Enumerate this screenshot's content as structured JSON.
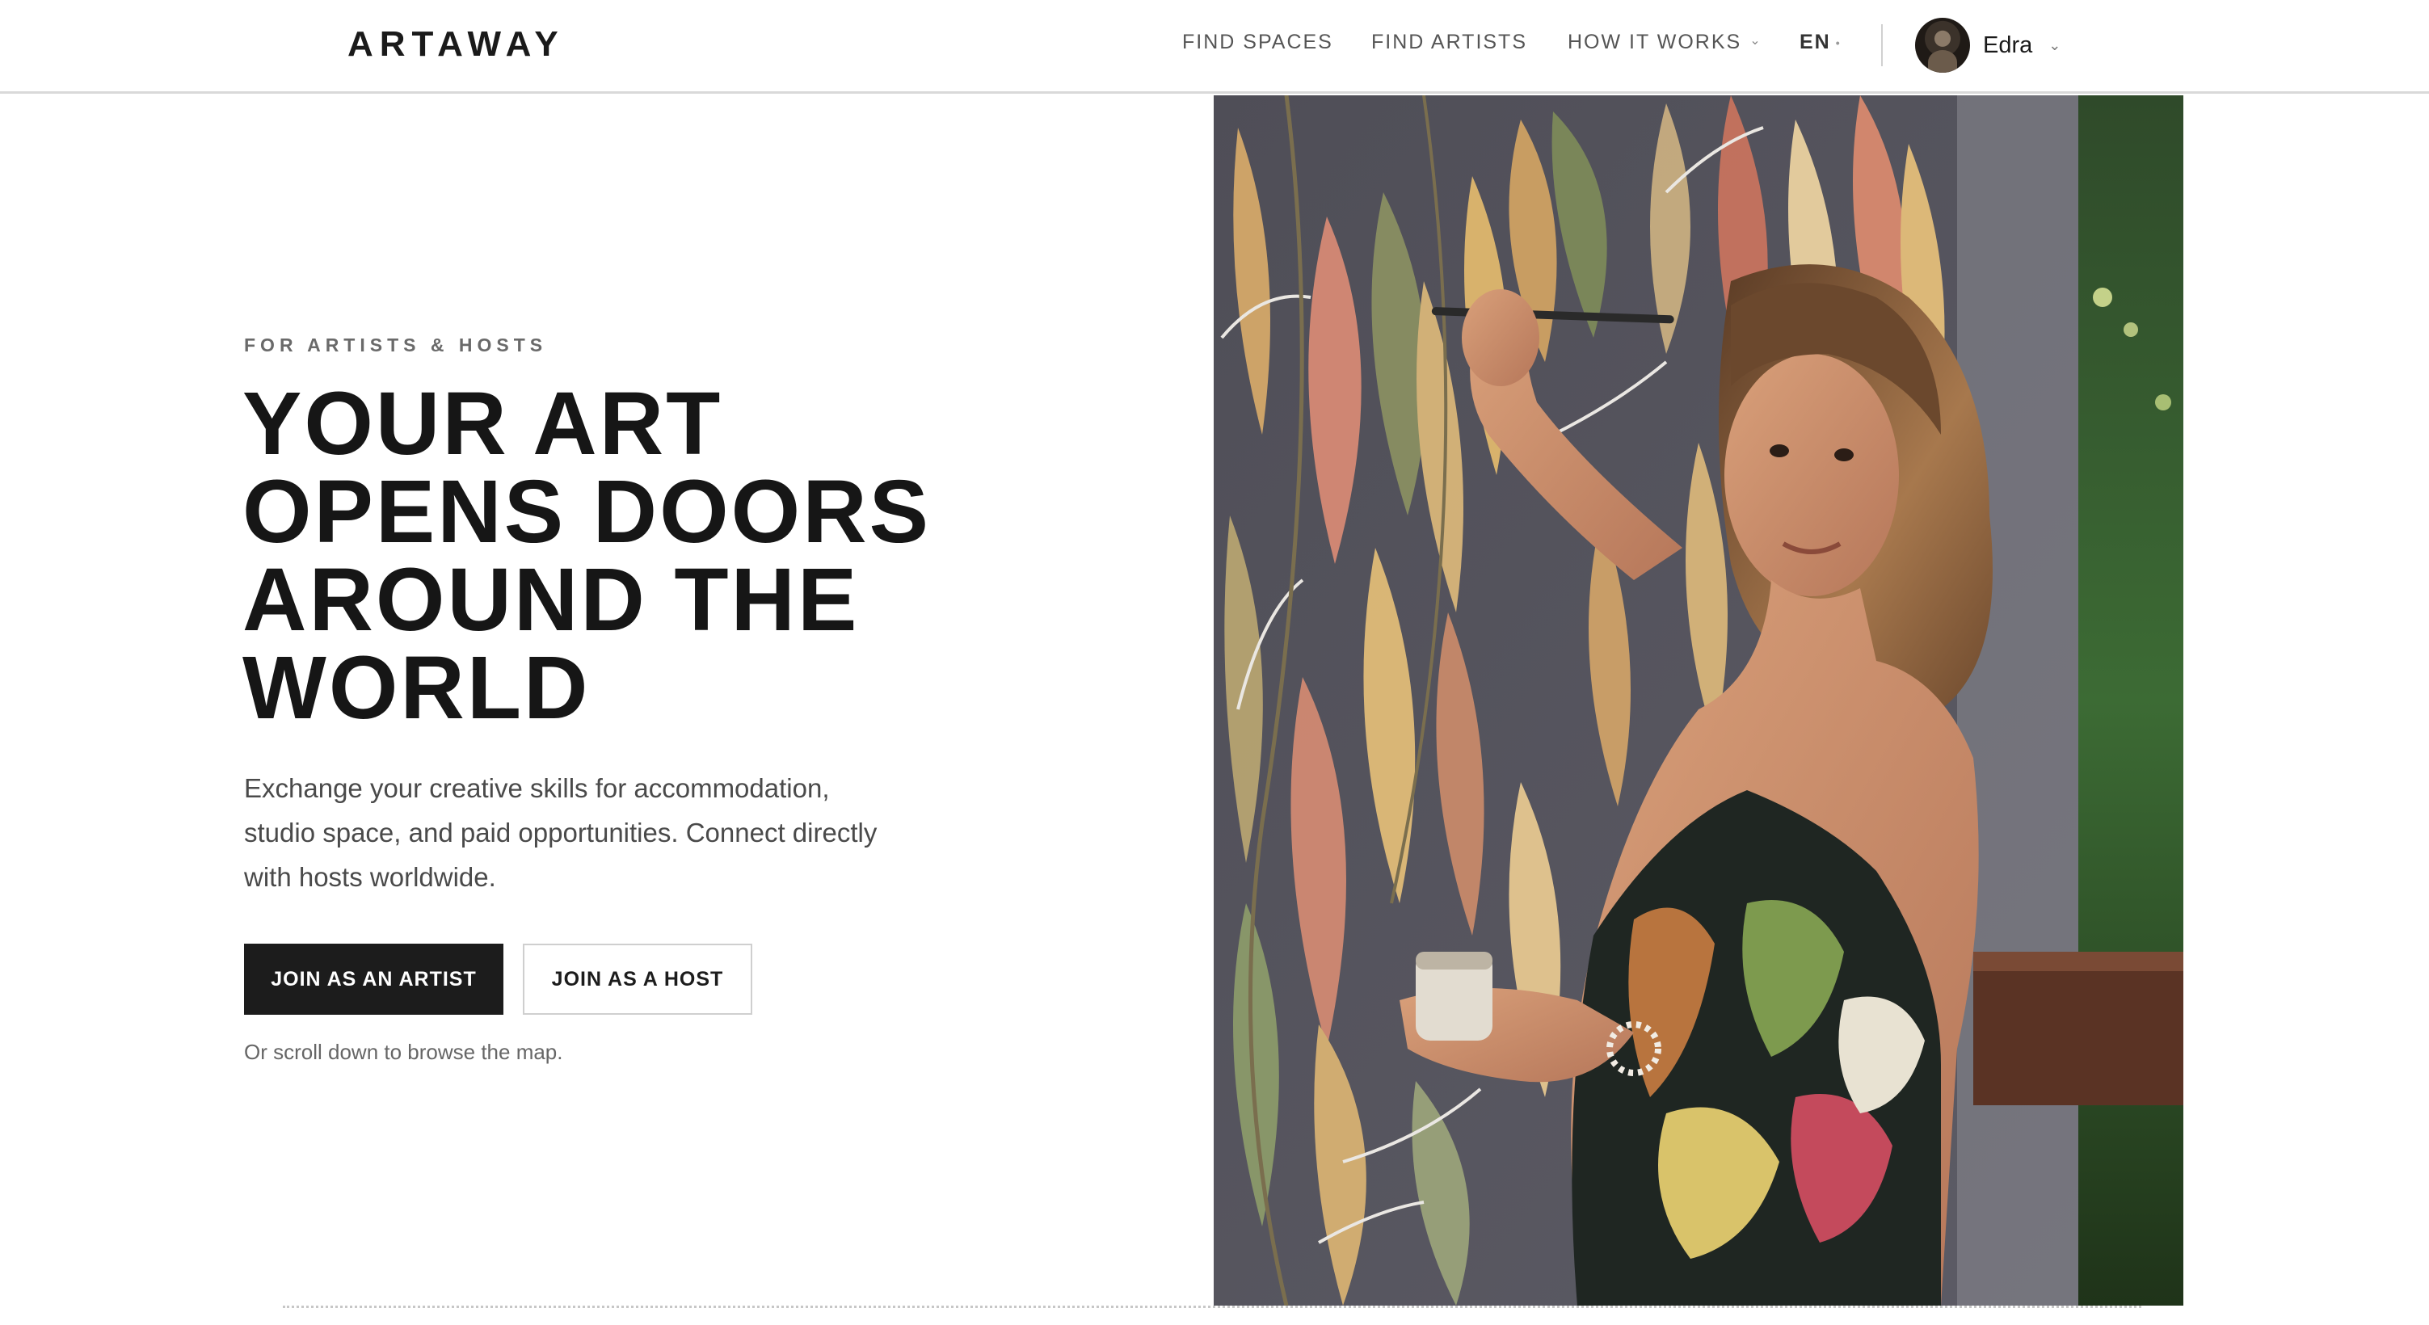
{
  "header": {
    "logo": "ARTAWAY",
    "nav": {
      "find_spaces": "FIND SPACES",
      "find_artists": "FIND ARTISTS",
      "how_it_works": "HOW IT WORKS",
      "language": "EN"
    },
    "user": {
      "name": "Edra"
    }
  },
  "hero": {
    "eyebrow": "FOR ARTISTS & HOSTS",
    "headline_lines": [
      "YOUR ART",
      "OPENS DOORS",
      "AROUND THE",
      "WORLD"
    ],
    "subtext": "Exchange your creative skills for accommodation, studio space, and paid opportunities. Connect directly with hosts worldwide.",
    "primary_button": "JOIN AS AN ARTIST",
    "secondary_button": "JOIN AS A HOST",
    "scroll_hint": "Or scroll down to browse the map."
  },
  "colors": {
    "text_dark": "#161616",
    "button_dark": "#1c1c1c",
    "muted": "#666666",
    "wall": "#55545c"
  },
  "icons": {
    "nav_dropdown": "chevron-down-icon",
    "user_dropdown": "chevron-down-icon",
    "avatar": "user-avatar"
  }
}
